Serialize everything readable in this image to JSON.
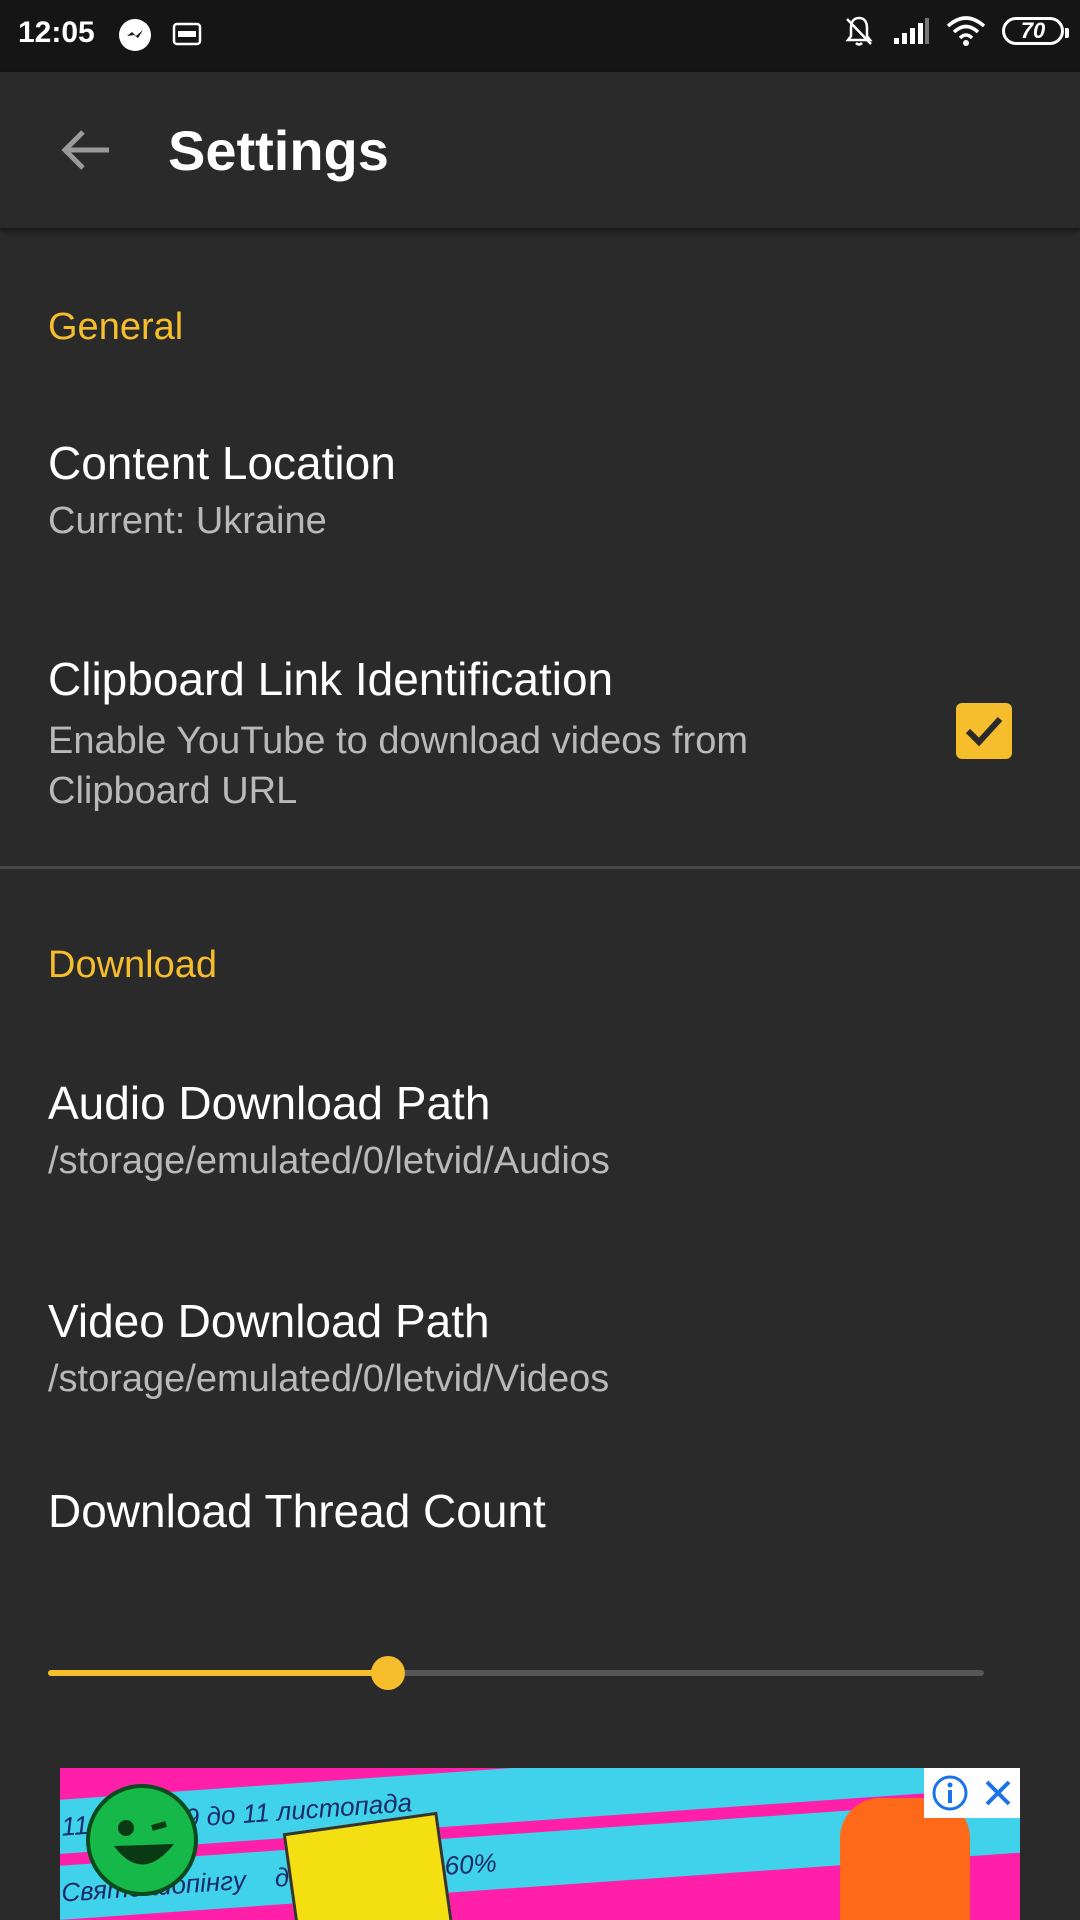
{
  "status_bar": {
    "time": "12:05",
    "left_icons": [
      "messenger-icon",
      "ftp-icon"
    ],
    "right_icons": [
      "bell-off-icon",
      "signal-icon",
      "wifi-icon"
    ],
    "battery": "70"
  },
  "app_bar": {
    "title": "Settings",
    "back_icon": "arrow-left-icon"
  },
  "sections": {
    "general": {
      "header": "General",
      "content_location": {
        "title": "Content Location",
        "summary": "Current: Ukraine"
      },
      "clipboard": {
        "title": "Clipboard Link Identification",
        "summary_line1": "Enable YouTube to download videos from",
        "summary_line2": "Clipboard URL",
        "checked": true
      }
    },
    "download": {
      "header": "Download",
      "audio_path": {
        "title": "Audio Download Path",
        "summary": "/storage/emulated/0/letvid/Audios"
      },
      "video_path": {
        "title": "Video Download Path",
        "summary": "/storage/emulated/0/letvid/Videos"
      },
      "thread_count": {
        "title": "Download Thread Count",
        "slider_fraction": 0.363
      }
    }
  },
  "ad": {
    "stripe_texts": [
      "з 9 до 11 листопада",
      "11.11",
      "Свято шопінгу",
      "до -60%"
    ],
    "info_icon": "info-icon",
    "close_icon": "close-icon"
  },
  "colors": {
    "accent": "#f6bd2c",
    "background": "#2a2a2a",
    "status_bar": "#151515",
    "summary_text": "#b9b9b9"
  }
}
